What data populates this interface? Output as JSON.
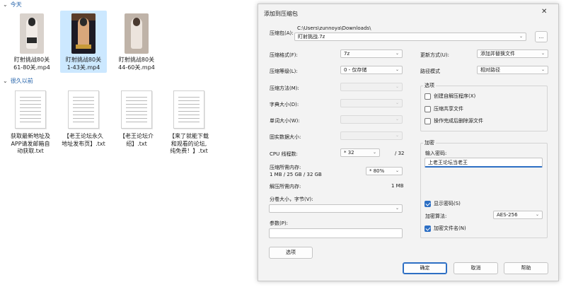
{
  "explorer": {
    "groups": [
      {
        "label": "今天",
        "chevron": "chevron-down-icon"
      },
      {
        "label": "很久以前",
        "chevron": "chevron-down-icon"
      }
    ],
    "video_files": [
      {
        "line1": "盯射挑战80关",
        "line2": "61-80关.mp4"
      },
      {
        "line1": "盯射挑战80关",
        "line2": "1-43关.mp4"
      },
      {
        "line1": "盯射挑战80关",
        "line2": "44-60关.mp4"
      }
    ],
    "text_files": [
      {
        "lines": [
          "获取最新地址及",
          "APP请发邮箱自",
          "动获取.txt"
        ]
      },
      {
        "lines": [
          "【老王论坛永久",
          "地址发布页】.txt"
        ]
      },
      {
        "lines": [
          "【老王论坛介",
          "绍】.txt"
        ]
      },
      {
        "lines": [
          "【来了就能下载",
          "和观看的论坛,",
          "纯免费！】.txt"
        ]
      }
    ]
  },
  "dialog": {
    "title": "添加到压缩包",
    "close_glyph": "✕",
    "archive_label": "压缩包(A):",
    "archive_path": "C:\\Users\\zunnoya\\Downloads\\",
    "archive_name": "盯射挑战.7z",
    "browse_label": "...",
    "format_label": "压缩格式(F):",
    "format_value": "7z",
    "level_label": "压缩等级(L):",
    "level_value": "0 - 仅存储",
    "method_label": "压缩方法(M):",
    "dict_label": "字典大小(D):",
    "word_label": "单词大小(W):",
    "solid_label": "固实数据大小:",
    "threads_label": "CPU 线程数:",
    "threads_value": "* 32",
    "threads_total": "/ 32",
    "mem_comp_label": "压缩所需内存:",
    "mem_comp_detail": "1 MB / 25 GB / 32 GB",
    "mem_comp_value": "* 80%",
    "mem_decomp_label": "解压所需内存:",
    "mem_decomp_value": "1 MB",
    "split_label": "分卷大小，字节(V):",
    "params_label": "参数(P):",
    "options_button": "选项",
    "update_label": "更新方式(U):",
    "update_value": "添加并替换文件",
    "path_label": "路径模式",
    "path_value": "相对路径",
    "options_group": "选项",
    "opt_sfx": "创建自解压程序(X)",
    "opt_shared": "压缩共享文件",
    "opt_delete": "操作完成后删除源文件",
    "enc_group": "加密",
    "enc_password_label": "输入密码:",
    "enc_password_value": "上老王论坛当老王",
    "enc_show_password": "显示密码(S)",
    "enc_method_label": "加密算法:",
    "enc_method_value": "AES-256",
    "enc_filenames": "加密文件名(N)",
    "ok": "确定",
    "cancel": "取消",
    "help": "帮助"
  }
}
